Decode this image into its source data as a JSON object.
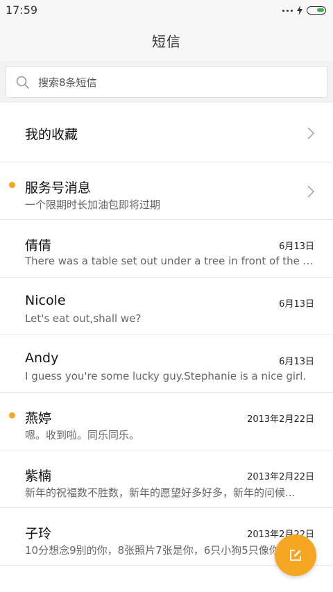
{
  "status": {
    "time": "17:59"
  },
  "header": {
    "title": "短信"
  },
  "search": {
    "placeholder": "搜索8条短信"
  },
  "favorites": {
    "label": "我的收藏"
  },
  "threads": [
    {
      "name": "服务号消息",
      "preview": "一个限期时长加油包即将过期",
      "date": "",
      "unread": true,
      "chevron": true
    },
    {
      "name": "倩倩",
      "preview": "There was a table set out under a tree in front of the ho...",
      "date": "6月13日",
      "unread": false
    },
    {
      "name": "Nicole",
      "preview": "Let's eat out,shall we?",
      "date": "6月13日",
      "unread": false
    },
    {
      "name": "Andy",
      "preview": "I guess you're some lucky guy.Stephanie is a nice girl.",
      "date": "6月13日",
      "unread": false
    },
    {
      "name": "燕婷",
      "preview": "嗯。收到啦。同乐同乐。",
      "date": "2013年2月22日",
      "unread": true
    },
    {
      "name": "紫楠",
      "preview": "新年的祝福数不胜数，新年的愿望好多好多，新年的问候...",
      "date": "2013年2月22日",
      "unread": false
    },
    {
      "name": "子玲",
      "preview": "10分想念9别的你，8张照片7张是你，6只小狗5只像你",
      "date": "2013年2月22日",
      "unread": false
    }
  ],
  "colors": {
    "accent": "#f5a623",
    "battery": "#36b24a"
  },
  "icons": {
    "compose": "compose-icon",
    "search": "search-icon",
    "chevron": "chevron-right-icon"
  }
}
